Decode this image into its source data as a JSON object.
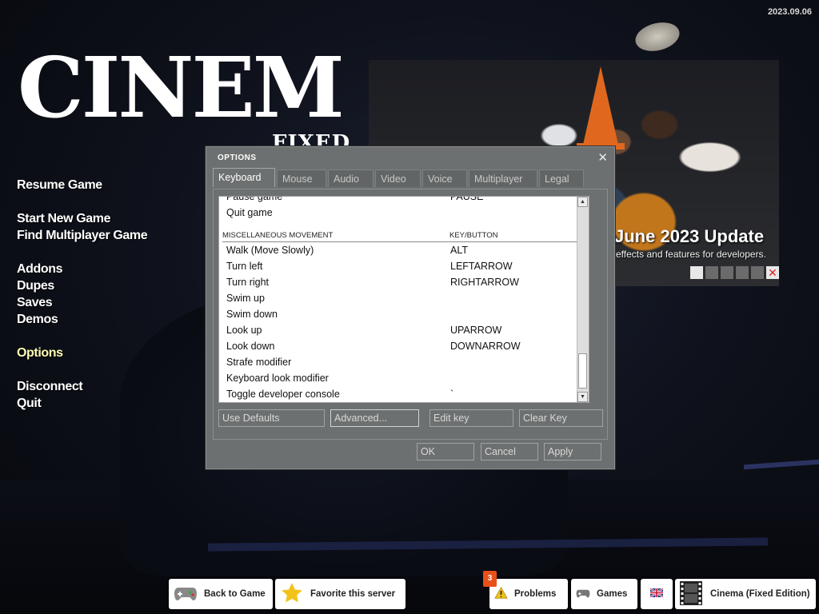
{
  "date": "2023.09.06",
  "logo": {
    "title": "CINEM",
    "subtitle": "FIXED"
  },
  "menu": {
    "resume": "Resume Game",
    "start_new": "Start New Game",
    "find_mp": "Find Multiplayer Game",
    "addons": "Addons",
    "dupes": "Dupes",
    "saves": "Saves",
    "demos": "Demos",
    "options": "Options",
    "disconnect": "Disconnect",
    "quit": "Quit"
  },
  "news": {
    "title": "June 2023 Update",
    "description": "effects and features for developers."
  },
  "dialog": {
    "title": "OPTIONS",
    "tabs": [
      "Keyboard",
      "Mouse",
      "Audio",
      "Video",
      "Voice",
      "Multiplayer",
      "Legal"
    ],
    "header": {
      "action": "MISCELLANEOUS MOVEMENT",
      "key": "KEY/BUTTON"
    },
    "rows_top": [
      {
        "action": "Pause game",
        "key": "PAUSE"
      },
      {
        "action": "Quit game",
        "key": ""
      }
    ],
    "rows": [
      {
        "action": "Walk (Move Slowly)",
        "key": "ALT"
      },
      {
        "action": "Turn left",
        "key": "LEFTARROW"
      },
      {
        "action": "Turn right",
        "key": "RIGHTARROW"
      },
      {
        "action": "Swim up",
        "key": ""
      },
      {
        "action": "Swim down",
        "key": ""
      },
      {
        "action": "Look up",
        "key": "UPARROW"
      },
      {
        "action": "Look down",
        "key": "DOWNARROW"
      },
      {
        "action": "Strafe modifier",
        "key": ""
      },
      {
        "action": "Keyboard look modifier",
        "key": ""
      },
      {
        "action": "Toggle developer console",
        "key": "`"
      }
    ],
    "buttons": {
      "use_defaults": "Use Defaults",
      "advanced": "Advanced...",
      "edit_key": "Edit key",
      "clear_key": "Clear Key",
      "ok": "OK",
      "cancel": "Cancel",
      "apply": "Apply"
    }
  },
  "bottom_bar": {
    "back_to_game": "Back to Game",
    "favorite": "Favorite this server",
    "problems": "Problems",
    "problems_count": "3",
    "games": "Games",
    "gamemode": "Cinema (Fixed Edition)"
  }
}
